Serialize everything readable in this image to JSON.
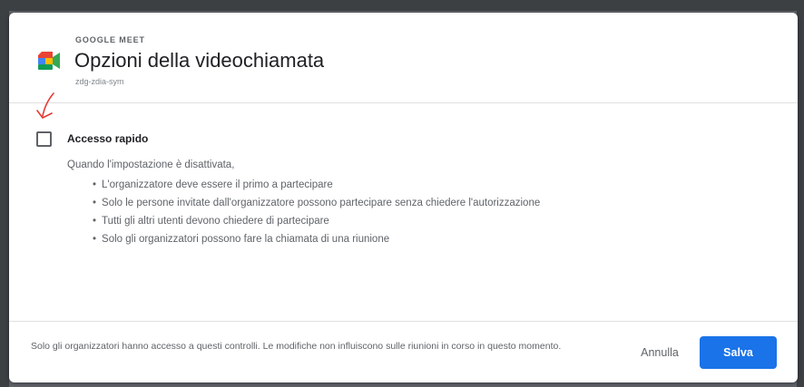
{
  "colors": {
    "accent": "#1a73e8",
    "annotation_arrow": "#e53935",
    "text_primary": "#202124",
    "text_secondary": "#5f6368"
  },
  "header": {
    "eyebrow": "GOOGLE MEET",
    "title": "Opzioni della videochiamata",
    "meeting_code": "zdg-zdia-sym",
    "logo_icon": "google-meet-logo"
  },
  "annotation": {
    "icon": "red-arrow-down-icon"
  },
  "quick_access": {
    "label": "Accesso rapido",
    "checked": false,
    "description": "Quando l'impostazione è disattivata,",
    "bullets": [
      "L'organizzatore deve essere il primo a partecipare",
      "Solo le persone invitate dall'organizzatore possono partecipare senza chiedere l'autorizzazione",
      "Tutti gli altri utenti devono chiedere di partecipare",
      "Solo gli organizzatori possono fare la chiamata di una riunione"
    ]
  },
  "footer": {
    "note": "Solo gli organizzatori hanno accesso a questi controlli. Le modifiche non influiscono sulle riunioni in corso in questo momento.",
    "cancel_label": "Annulla",
    "save_label": "Salva"
  }
}
